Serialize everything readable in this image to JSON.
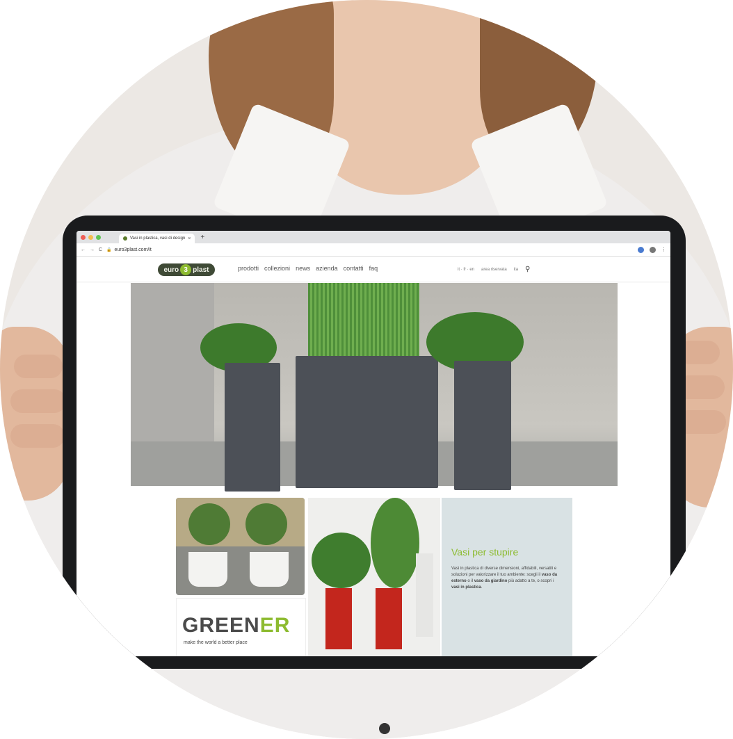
{
  "browser": {
    "tab_title": "Vasi in plastica, vasi di design",
    "tab_close": "×",
    "new_tab": "+",
    "url": "euro3plast.com/it",
    "nav_back": "←",
    "nav_forward": "→",
    "nav_reload": "C"
  },
  "site": {
    "logo": {
      "left": "euro",
      "middle": "3",
      "right": "plast"
    },
    "menu": [
      "prodotti",
      "collezioni",
      "news",
      "azienda",
      "contatti",
      "faq"
    ],
    "nav_right": {
      "lang": "it · fr · en",
      "reserved_area": "area riservata",
      "language": "ita"
    }
  },
  "tiles": {
    "greener": {
      "gr": "GR",
      "ee": "EE",
      "n": "N",
      "er": "ER",
      "tagline": "make the world a better place"
    },
    "vasi": {
      "title": "Vasi per stupire",
      "text_1": "Vasi in plastica di diverse dimensioni, affidabili, versatili e soluzioni per valorizzare il tuo ambiente: scegli il ",
      "bold_1": "vaso da esterno",
      "text_2": " o il ",
      "bold_2": "vaso da giardino",
      "text_3": " più adatto a te, o scopri i ",
      "bold_3": "vasi in plastica",
      "text_4": "."
    }
  },
  "colors": {
    "brand_green": "#8dbb30",
    "logo_dark": "#3f4a36",
    "pot_gray": "#4c5057"
  }
}
